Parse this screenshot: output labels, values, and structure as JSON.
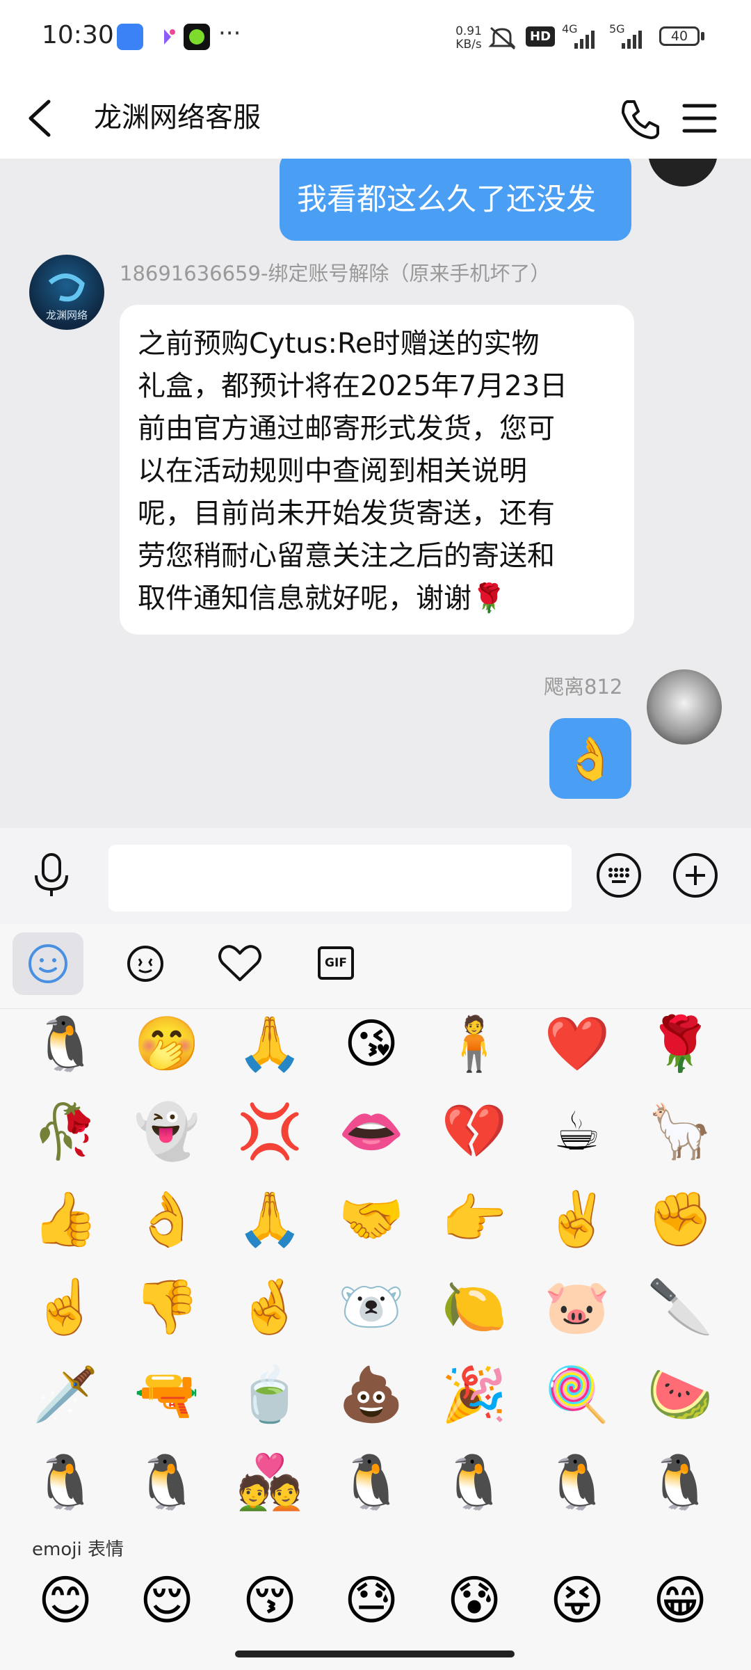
{
  "status_bar": {
    "time": "10:30",
    "net_speed_value": "0.91",
    "net_speed_unit": "KB/s",
    "hd_label": "HD",
    "net1": "4G",
    "net2": "5G",
    "battery": "40",
    "more": "···",
    "colors": {
      "app1": "#3b82f6",
      "app3": "#7ddc2b"
    }
  },
  "header": {
    "title": "龙渊网络客服",
    "back_icon": "chevron-left-icon",
    "call_icon": "phone-icon",
    "menu_icon": "hamburger-menu-icon"
  },
  "messages": {
    "m1_text": "我看都这么久了还没发",
    "agent_name": "18691636659-绑定账号解除（原来手机坏了）",
    "agent_avatar_text": "龙渊网络",
    "m2_lines": [
      "之前预购Cytus:Re时赠送的实物",
      "礼盒，都预计将在2025年7月23日",
      "前由官方通过邮寄形式发货，您可",
      "以在活动规则中查阅到相关说明",
      "呢，目前尚未开始发货寄送，还有",
      "劳您稍耐心留意关注之后的寄送和",
      "取件通知信息就好呢，谢谢🌹"
    ],
    "user_name": "飔离812",
    "m3_emoji": "👌"
  },
  "input": {
    "mic_icon": "microphone-icon",
    "keyboard_icon": "keyboard-icon",
    "plus_icon": "plus-circle-icon"
  },
  "emoji_tabs": {
    "tab1": "smiley-icon",
    "tab2": "sparkle-face-icon",
    "tab3": "heart-outline-icon",
    "tab4": "GIF"
  },
  "emoji_grid": [
    [
      "🐧",
      "🤭",
      "🙏",
      "😘",
      "🧍",
      "❤️",
      "🌹"
    ],
    [
      "🥀",
      "👻",
      "💢",
      "👄",
      "💔",
      "☕",
      "🦙"
    ],
    [
      "👍",
      "👌",
      "🙏",
      "🤝",
      "👉",
      "✌️",
      "✊"
    ],
    [
      "☝️",
      "👎",
      "🤞",
      "🐻‍❄️",
      "🍋",
      "🐷",
      "🔪"
    ],
    [
      "🗡️",
      "🔫",
      "🍵",
      "💩",
      "🎉",
      "🍭",
      "🍉"
    ],
    [
      "🐧",
      "🐧",
      "💑",
      "🐧",
      "🐧",
      "🐧",
      "🐧"
    ]
  ],
  "emoji_section_label": "emoji 表情",
  "emoji_row2": [
    "😊",
    "😌",
    "😚",
    "😓",
    "😰",
    "😝",
    "😁"
  ]
}
